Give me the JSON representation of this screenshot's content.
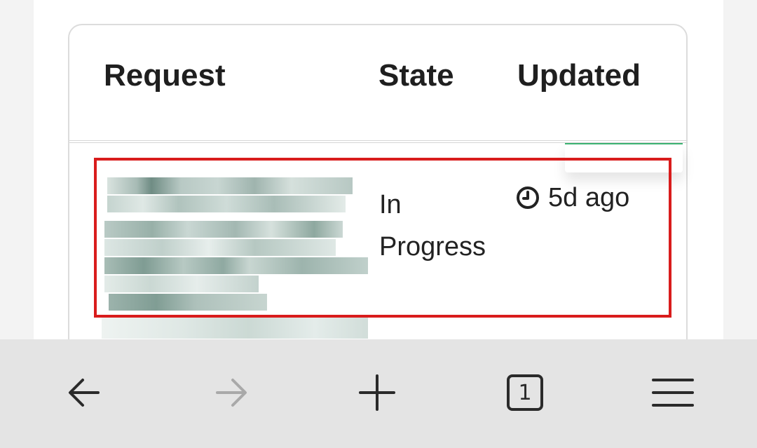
{
  "table": {
    "headers": {
      "request": "Request",
      "state": "State",
      "updated": "Updated"
    },
    "rows": [
      {
        "request": "",
        "state": "In Progress",
        "updated": "5d ago"
      }
    ]
  },
  "browser_toolbar": {
    "tab_count": "1",
    "icons": [
      "back-arrow-icon",
      "forward-arrow-icon",
      "new-tab-plus-icon",
      "tab-switcher-icon",
      "menu-hamburger-icon"
    ]
  },
  "colors": {
    "highlight_border": "#d91c1c",
    "accent_green": "#3cb371",
    "toolbar_bg": "#e4e4e4",
    "text": "#222222"
  }
}
